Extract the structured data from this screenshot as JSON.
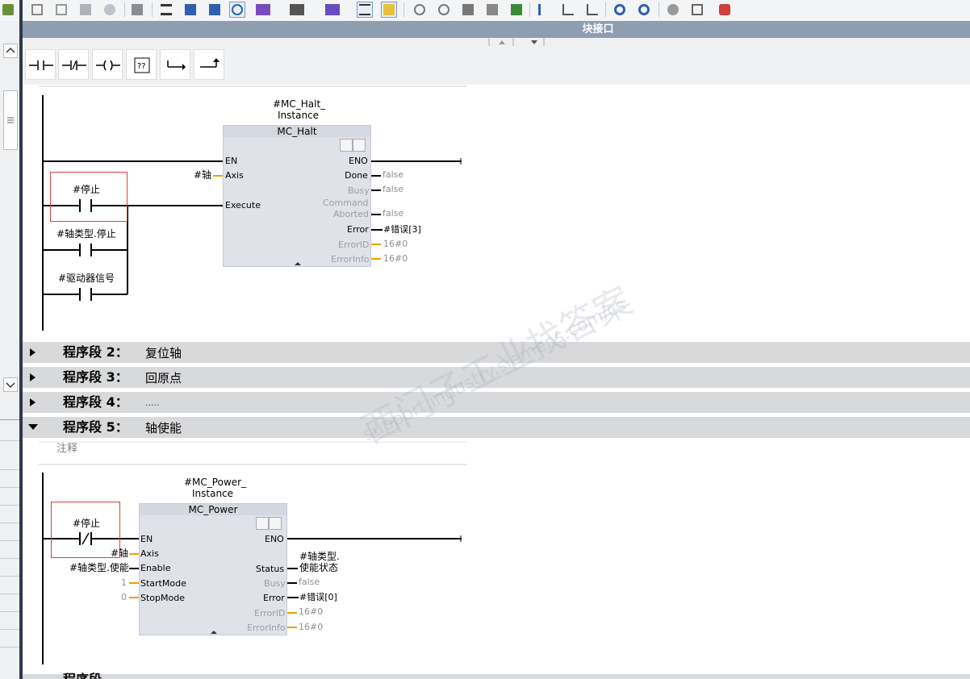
{
  "editor": {
    "title": "块接口"
  },
  "toolbar": {
    "icons": [
      "insert-network-icon",
      "delete-network-icon",
      "insert-row-icon",
      "add-row-icon",
      "go-online-icon",
      "absolute-address-icon",
      "symbolic-address-icon",
      "symbol-info-icon",
      "comment-icon",
      "favorites-icon",
      "instructions-icon",
      "libraries-icon",
      "network-list-icon",
      "starred-icon",
      "monitor-icon",
      "modify-icon",
      "snapshot-icon",
      "download-icon",
      "accept-icon",
      "go-to-next-error-icon",
      "go-to-previous-error-icon",
      "go-up-icon",
      "go-down-icon",
      "zoom-icon",
      "watch-table-icon",
      "database-icon"
    ]
  },
  "palette": {
    "items": [
      "normally-open-contact",
      "normally-closed-contact",
      "coil",
      "empty-box",
      "open-branch",
      "close-branch"
    ]
  },
  "networks": {
    "n1": {
      "instance": "#MC_Halt_\nInstance",
      "instance_l1": "#MC_Halt_",
      "instance_l2": "Instance",
      "block": "MC_Halt",
      "inputs": {
        "en": "EN",
        "axis": "Axis",
        "execute": "Execute"
      },
      "outputs": {
        "eno": "ENO",
        "done": "Done",
        "busy": "Busy",
        "cmd1": "Command",
        "cmd2": "Aborted",
        "error": "Error",
        "errorid": "ErrorID",
        "errorinfo": "ErrorInfo"
      },
      "axis_tag": "#轴",
      "contact1": "#停止",
      "contact2": "#轴类型.停止",
      "contact3": "#驱动器信号",
      "values": {
        "done": "false",
        "busy": "false",
        "cmd": "false",
        "error": "#错误[3]",
        "errorid": "16#0",
        "errorinfo": "16#0"
      }
    },
    "n2": {
      "number": "程序段 2：",
      "title": "复位轴"
    },
    "n3": {
      "number": "程序段 3：",
      "title": "回原点"
    },
    "n4": {
      "number": "程序段 4：",
      "title": "....."
    },
    "n5": {
      "number": "程序段 5：",
      "title": "轴使能",
      "comment": "注释",
      "instance_l1": "#MC_Power_",
      "instance_l2": "Instance",
      "block": "MC_Power",
      "inputs": {
        "en": "EN",
        "axis": "Axis",
        "enable": "Enable",
        "startmode": "StartMode",
        "stopmode": "StopMode"
      },
      "outputs": {
        "eno": "ENO",
        "status": "Status",
        "busy": "Busy",
        "error": "Error",
        "errorid": "ErrorID",
        "errorinfo": "ErrorInfo"
      },
      "contact1": "#停止",
      "axis_tag": "#轴",
      "enable_tag": "#轴类型.使能",
      "startmode_val": "1",
      "stopmode_val": "0",
      "status_l1": "#轴类型.",
      "status_l2": "使能状态",
      "values": {
        "busy": "false",
        "error": "#错误[0]",
        "errorid": "16#0",
        "errorinfo": "16#0"
      }
    },
    "n6": {
      "number": "程序段"
    }
  },
  "watermark": {
    "line1": "西门子工业",
    "line2": "找答案",
    "line3": "support.industry.siemens.com/cs"
  },
  "colors": {
    "header": "#8f9db0",
    "segment_bar": "#d8d9db",
    "highlight": "#e04040",
    "pin_stub": "#f0a000",
    "fb_body": "#dfe2e8"
  }
}
